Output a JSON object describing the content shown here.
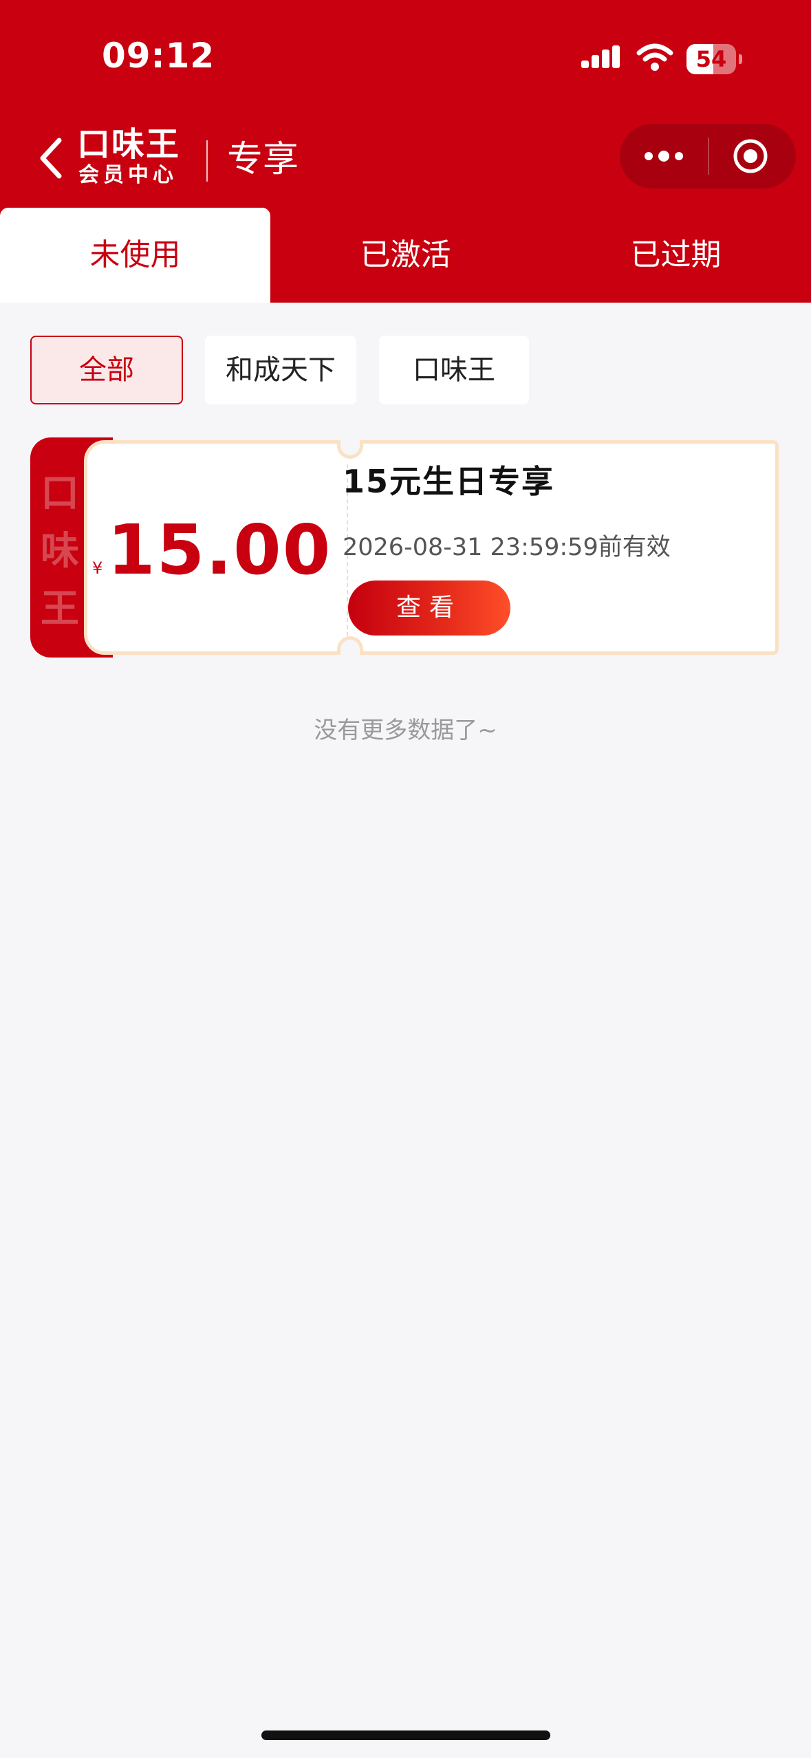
{
  "status_bar": {
    "time": "09:12",
    "battery_percent": "54",
    "battery_level": 0.54
  },
  "nav": {
    "brand_top": "口味王",
    "brand_bottom": "会员中心",
    "title": "专享"
  },
  "tabs": [
    {
      "label": "未使用",
      "active": true
    },
    {
      "label": "已激活",
      "active": false
    },
    {
      "label": "已过期",
      "active": false
    }
  ],
  "filters": [
    {
      "label": "全部",
      "active": true
    },
    {
      "label": "和成天下",
      "active": false
    },
    {
      "label": "口味王",
      "active": false
    }
  ],
  "coupon": {
    "strip_text": [
      "口",
      "味",
      "王"
    ],
    "currency": "¥",
    "amount": "15.00",
    "name": "15元生日专享",
    "expiry": "2026-08-31 23:59:59前有效",
    "button_label": "查看"
  },
  "footer_text": "没有更多数据了~",
  "colors": {
    "brand_red": "#c8000f",
    "capsule_red": "#a90010",
    "coupon_border": "#fbe1c4",
    "background": "#f6f6f9"
  }
}
